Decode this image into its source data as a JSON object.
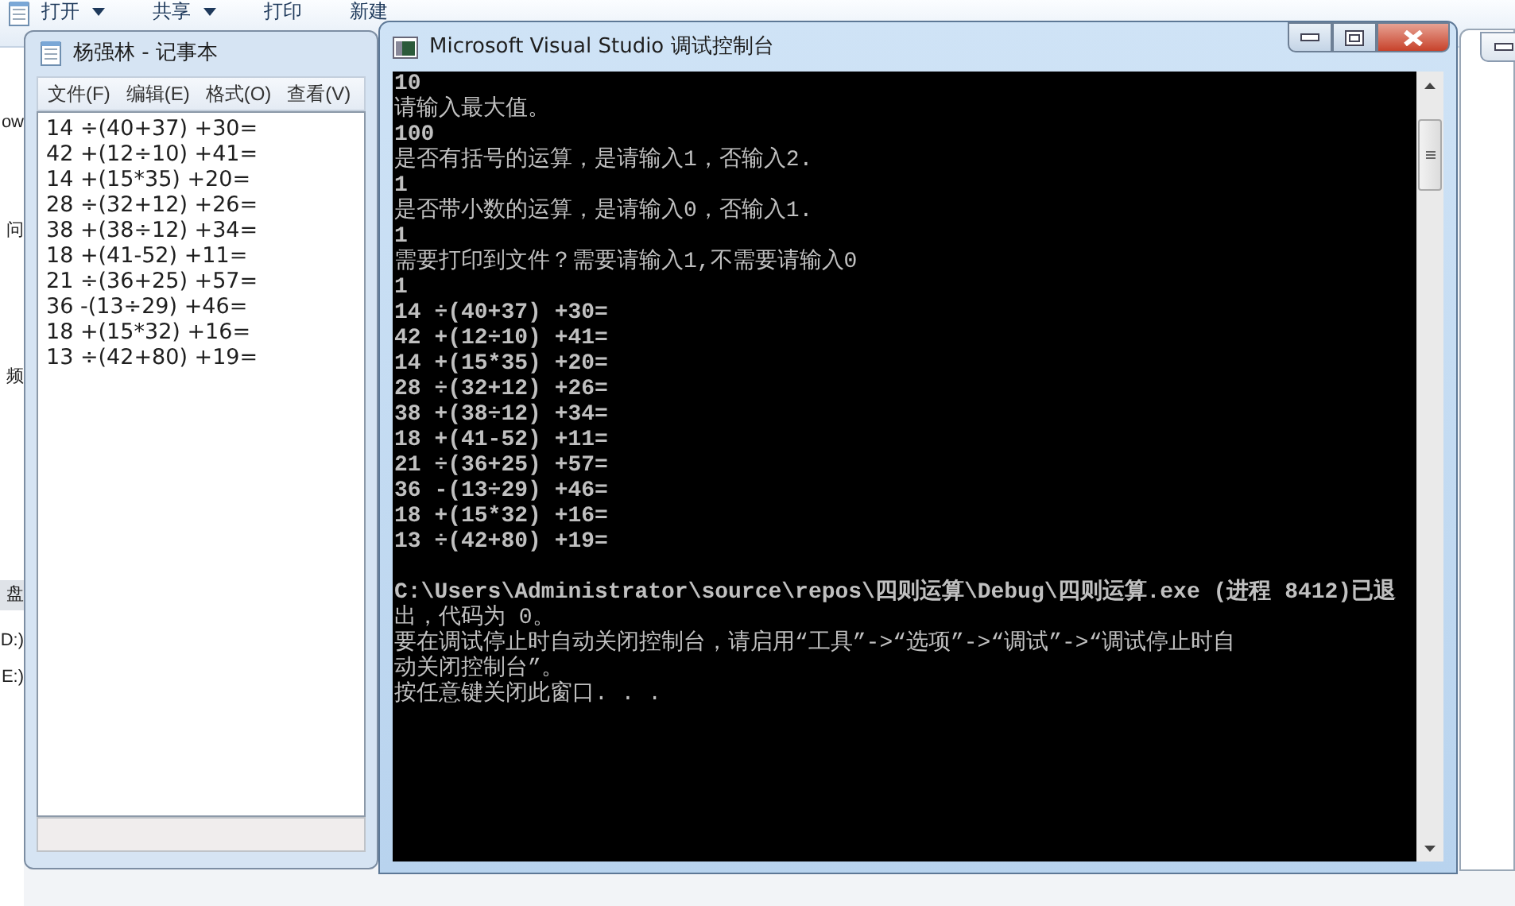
{
  "explorer": {
    "toolbar": [
      {
        "label": "打开",
        "dropdown": true
      },
      {
        "label": "共享",
        "dropdown": true
      },
      {
        "label": "打印",
        "dropdown": false
      },
      {
        "label": "新建",
        "dropdown": false
      }
    ],
    "sidebar": {
      "items": [
        {
          "label": "ow",
          "selected": false
        },
        {
          "label": "问",
          "selected": false
        },
        {
          "label": "频",
          "selected": false
        },
        {
          "label": "盘",
          "selected": true
        },
        {
          "label": "D:)",
          "selected": false
        },
        {
          "label": "E:)",
          "selected": false
        }
      ]
    }
  },
  "notepad": {
    "title": "杨强林 - 记事本",
    "menu": [
      "文件(F)",
      "编辑(E)",
      "格式(O)",
      "查看(V)"
    ],
    "lines": [
      "14 ÷(40+37) +30=",
      "42 +(12÷10) +41=",
      "14 +(15*35) +20=",
      "28 ÷(32+12) +26=",
      "38 +(38÷12) +34=",
      "18 +(41-52) +11=",
      "21 ÷(36+25) +57=",
      "36 -(13÷29) +46=",
      "18 +(15*32) +16=",
      "13 ÷(42+80) +19="
    ]
  },
  "console": {
    "title": "Microsoft Visual Studio 调试控制台",
    "lines": [
      {
        "kind": "echo",
        "text": "10"
      },
      {
        "kind": "message",
        "text": "请输入最大值。"
      },
      {
        "kind": "echo",
        "text": "100"
      },
      {
        "kind": "message",
        "text": "是否有括号的运算，是请输入1，否输入2."
      },
      {
        "kind": "echo",
        "text": "1"
      },
      {
        "kind": "message",
        "text": "是否带小数的运算，是请输入0，否输入1."
      },
      {
        "kind": "echo",
        "text": "1"
      },
      {
        "kind": "message",
        "text": "需要打印到文件？需要请输入1,不需要请输入0"
      },
      {
        "kind": "echo",
        "text": "1"
      },
      {
        "kind": "echo",
        "text": "14 ÷(40+37) +30="
      },
      {
        "kind": "echo",
        "text": "42 +(12÷10) +41="
      },
      {
        "kind": "echo",
        "text": "14 +(15*35) +20="
      },
      {
        "kind": "echo",
        "text": "28 ÷(32+12) +26="
      },
      {
        "kind": "echo",
        "text": "38 +(38÷12) +34="
      },
      {
        "kind": "echo",
        "text": "18 +(41-52) +11="
      },
      {
        "kind": "echo",
        "text": "21 ÷(36+25) +57="
      },
      {
        "kind": "echo",
        "text": "36 -(13÷29) +46="
      },
      {
        "kind": "echo",
        "text": "18 +(15*32) +16="
      },
      {
        "kind": "echo",
        "text": "13 ÷(42+80) +19="
      },
      {
        "kind": "blank"
      },
      {
        "kind": "echo",
        "text": "C:\\Users\\Administrator\\source\\repos\\四则运算\\Debug\\四则运算.exe (进程 8412)已退"
      },
      {
        "kind": "message",
        "text": "出，代码为 0。"
      },
      {
        "kind": "message",
        "text": "要在调试停止时自动关闭控制台，请启用“工具”->“选项”->“调试”->“调试停止时自"
      },
      {
        "kind": "message",
        "text": "动关闭控制台”。"
      },
      {
        "kind": "message",
        "text": "按任意键关闭此窗口. . ."
      }
    ]
  }
}
